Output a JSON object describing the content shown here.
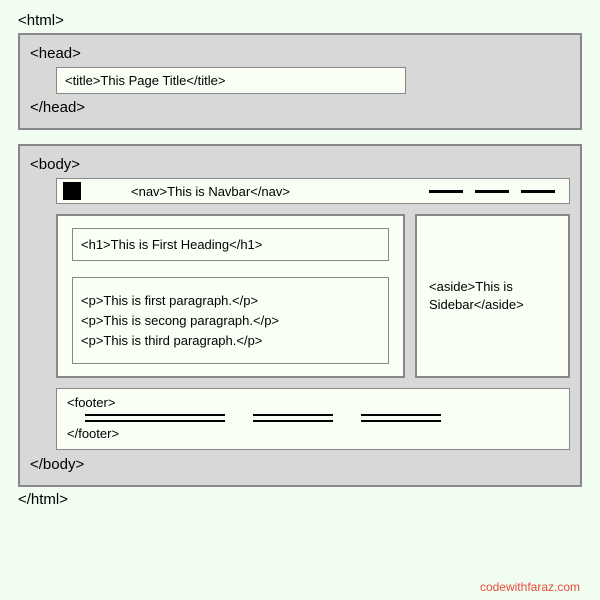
{
  "tags": {
    "html_open": "<html>",
    "html_close": "</html>",
    "head_open": "<head>",
    "head_close": "</head>",
    "body_open": "<body>",
    "body_close": "</body>",
    "footer_open": "<footer>",
    "footer_close": "</footer>"
  },
  "title_line": "<title>This Page Title</title>",
  "nav_line": "<nav>This is Navbar</nav>",
  "h1_line": "<h1>This is First Heading</h1>",
  "paragraphs": {
    "p1": "<p>This is first paragraph.</p>",
    "p2": "<p>This is secong paragraph.</p>",
    "p3": "<p>This is third paragraph.</p>"
  },
  "aside_line": "<aside>This is Sidebar</aside>",
  "attribution": "codewithfaraz.com"
}
